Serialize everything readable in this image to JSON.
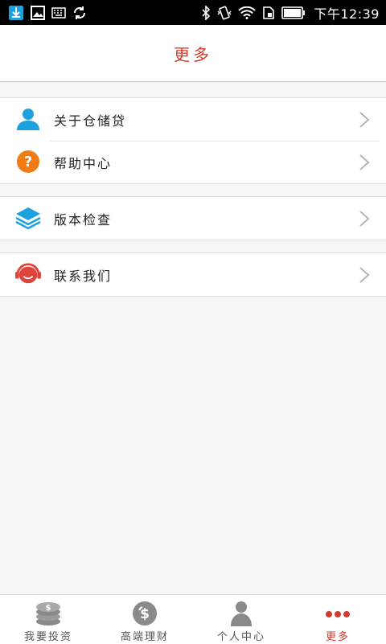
{
  "status_bar": {
    "time": "下午12:39",
    "left_icons": [
      "download-icon",
      "image-icon",
      "keyboard-icon",
      "sync-icon"
    ],
    "right_icons": [
      "bluetooth-icon",
      "vibrate-icon",
      "wifi-icon",
      "sim-icon",
      "battery-icon"
    ]
  },
  "header": {
    "title": "更多"
  },
  "menu": {
    "group1": [
      {
        "label": "关于仓储贷",
        "icon": "user-icon",
        "color": "#1aa1de"
      },
      {
        "label": "帮助中心",
        "icon": "question-icon",
        "color": "#f07c13"
      }
    ],
    "group2": [
      {
        "label": "版本检查",
        "icon": "layers-icon",
        "color": "#1aa1de"
      }
    ],
    "group3": [
      {
        "label": "联系我们",
        "icon": "headset-icon",
        "color": "#e0443a"
      }
    ]
  },
  "bottom_nav": {
    "items": [
      {
        "label": "我要投资",
        "icon": "coins-icon",
        "active": false
      },
      {
        "label": "高端理财",
        "icon": "dollar-icon",
        "active": false
      },
      {
        "label": "个人中心",
        "icon": "person-icon",
        "active": false
      },
      {
        "label": "更多",
        "icon": "more-dots-icon",
        "active": true
      }
    ],
    "active_color": "#d33a2c"
  }
}
